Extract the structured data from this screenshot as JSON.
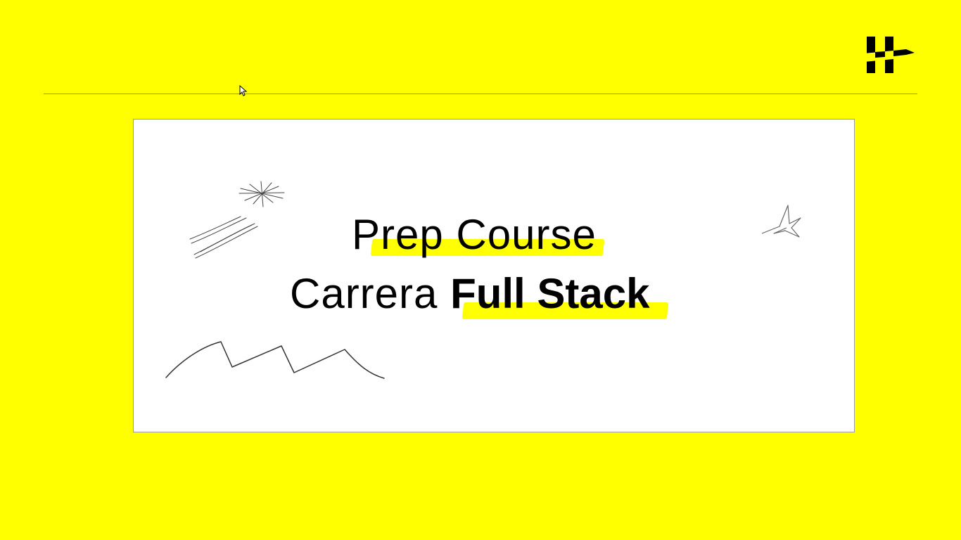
{
  "colors": {
    "background": "#FFFF00",
    "slide": "#FFFFFF",
    "text": "#000000",
    "highlight": "#FFFF00"
  },
  "logo": {
    "icon": "henry-logo-icon"
  },
  "cursor": {
    "icon": "mouse-pointer-icon"
  },
  "slide": {
    "line1": "Prep Course",
    "line2_regular": "Carrera",
    "line2_bold": "Full Stack",
    "doodles": [
      "sparkle-doodle",
      "star-doodle",
      "zigzag-doodle"
    ]
  }
}
